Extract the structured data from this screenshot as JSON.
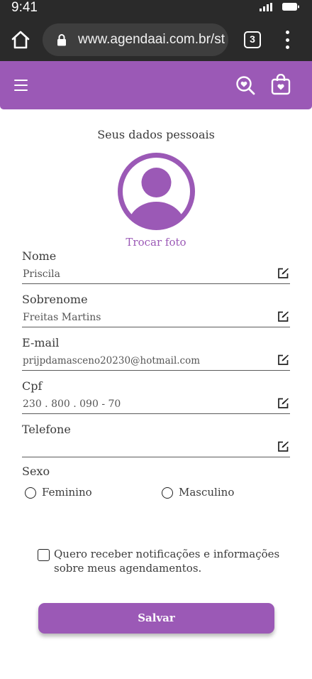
{
  "status_bar": {
    "time": "9:41",
    "icons": [
      "signal-icon",
      "battery-icon"
    ]
  },
  "browser": {
    "url": "www.agendaai.com.br/st",
    "tab_count": "3",
    "icons": [
      "home-icon",
      "lock-icon",
      "tabs-icon",
      "more-vertical-icon"
    ]
  },
  "header": {
    "background": "#9b59b6",
    "icons": [
      "menu-icon",
      "search-heart-icon",
      "shopping-bag-icon"
    ]
  },
  "profile": {
    "title": "Seus dados pessoais",
    "change_photo": "Trocar foto",
    "avatar_icon": "user-avatar-icon"
  },
  "fields": {
    "nome": {
      "label": "Nome",
      "value": "Priscila"
    },
    "sobrenome": {
      "label": "Sobrenome",
      "value": "Freitas Martins"
    },
    "email": {
      "label": "E-mail",
      "value": "prijpdamasceno20230@hotmail.com"
    },
    "cpf": {
      "label": "Cpf",
      "value": "230 . 800 . 090 - 70"
    },
    "telefone": {
      "label": "Telefone",
      "value": ""
    }
  },
  "sexo": {
    "label": "Sexo",
    "options": [
      {
        "label": "Feminino",
        "selected": false
      },
      {
        "label": "Masculino",
        "selected": false
      }
    ]
  },
  "notifications": {
    "label": "Quero receber notificações e informações sobre meus agendamentos.",
    "checked": false
  },
  "save_label": "Salvar",
  "colors": {
    "accent": "#9b59b6",
    "browser_chrome": "#2a2a2a"
  }
}
